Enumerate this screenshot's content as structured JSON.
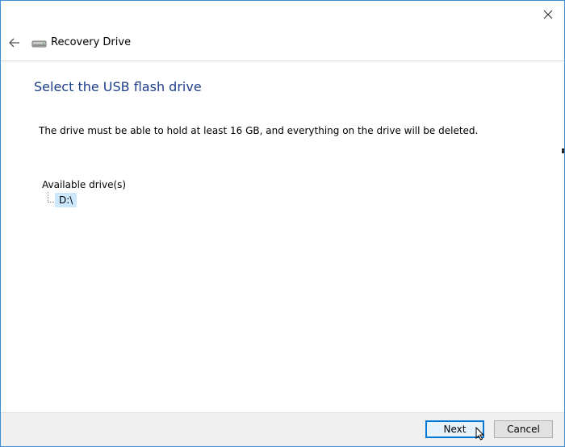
{
  "window": {
    "close_icon": "close-icon"
  },
  "nav": {
    "back_icon": "back-arrow-icon",
    "app_icon": "drive-icon",
    "title": "Recovery Drive"
  },
  "main": {
    "heading": "Select the USB flash drive",
    "description": "The drive must be able to hold at least 16 GB, and everything on the drive will be deleted.",
    "drives_label": "Available drive(s)",
    "drives": [
      {
        "label": "D:\\",
        "selected": true
      }
    ]
  },
  "footer": {
    "next_label": "Next",
    "cancel_label": "Cancel"
  },
  "colors": {
    "heading": "#1e3f8b",
    "selection": "#cce8ff",
    "focus_border": "#0078d7",
    "window_border": "#3b8fd8"
  }
}
